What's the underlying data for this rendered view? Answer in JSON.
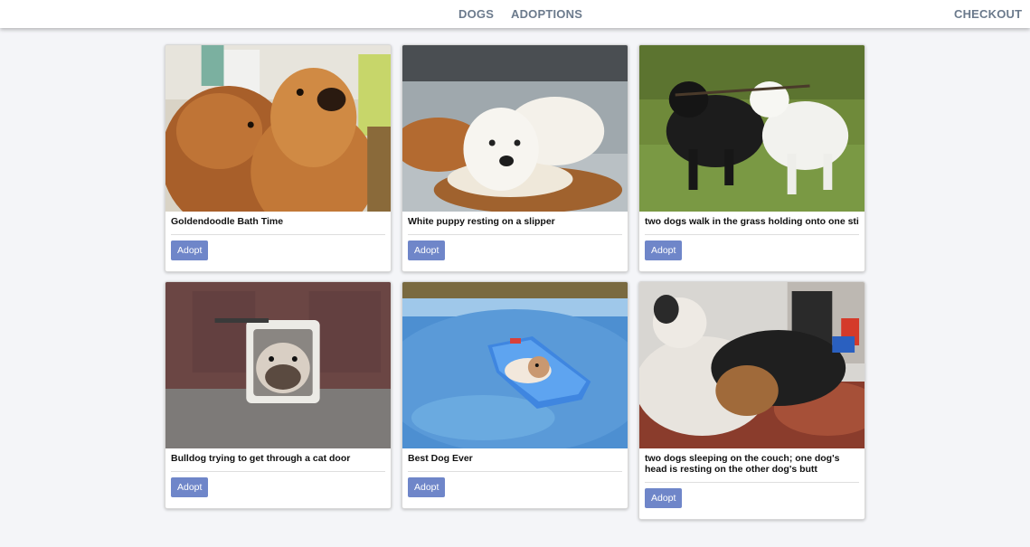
{
  "nav": {
    "dogs": "DOGS",
    "adoptions": "ADOPTIONS",
    "checkout": "CHECKOUT"
  },
  "cards": [
    {
      "title": "Goldendoodle Bath Time",
      "button": "Adopt"
    },
    {
      "title": "White puppy resting on a slipper",
      "button": "Adopt"
    },
    {
      "title": "two dogs walk in the grass holding onto one stic",
      "button": "Adopt"
    },
    {
      "title": "Bulldog trying to get through a cat door",
      "button": "Adopt"
    },
    {
      "title": "Best Dog Ever",
      "button": "Adopt"
    },
    {
      "title": "two dogs sleeping on the couch; one dog's head is resting on the other dog's butt",
      "button": "Adopt"
    }
  ],
  "colors": {
    "nav_text": "#6b7a8c",
    "adopt_button": "#6f86c9",
    "page_bg": "#f4f5f8"
  }
}
